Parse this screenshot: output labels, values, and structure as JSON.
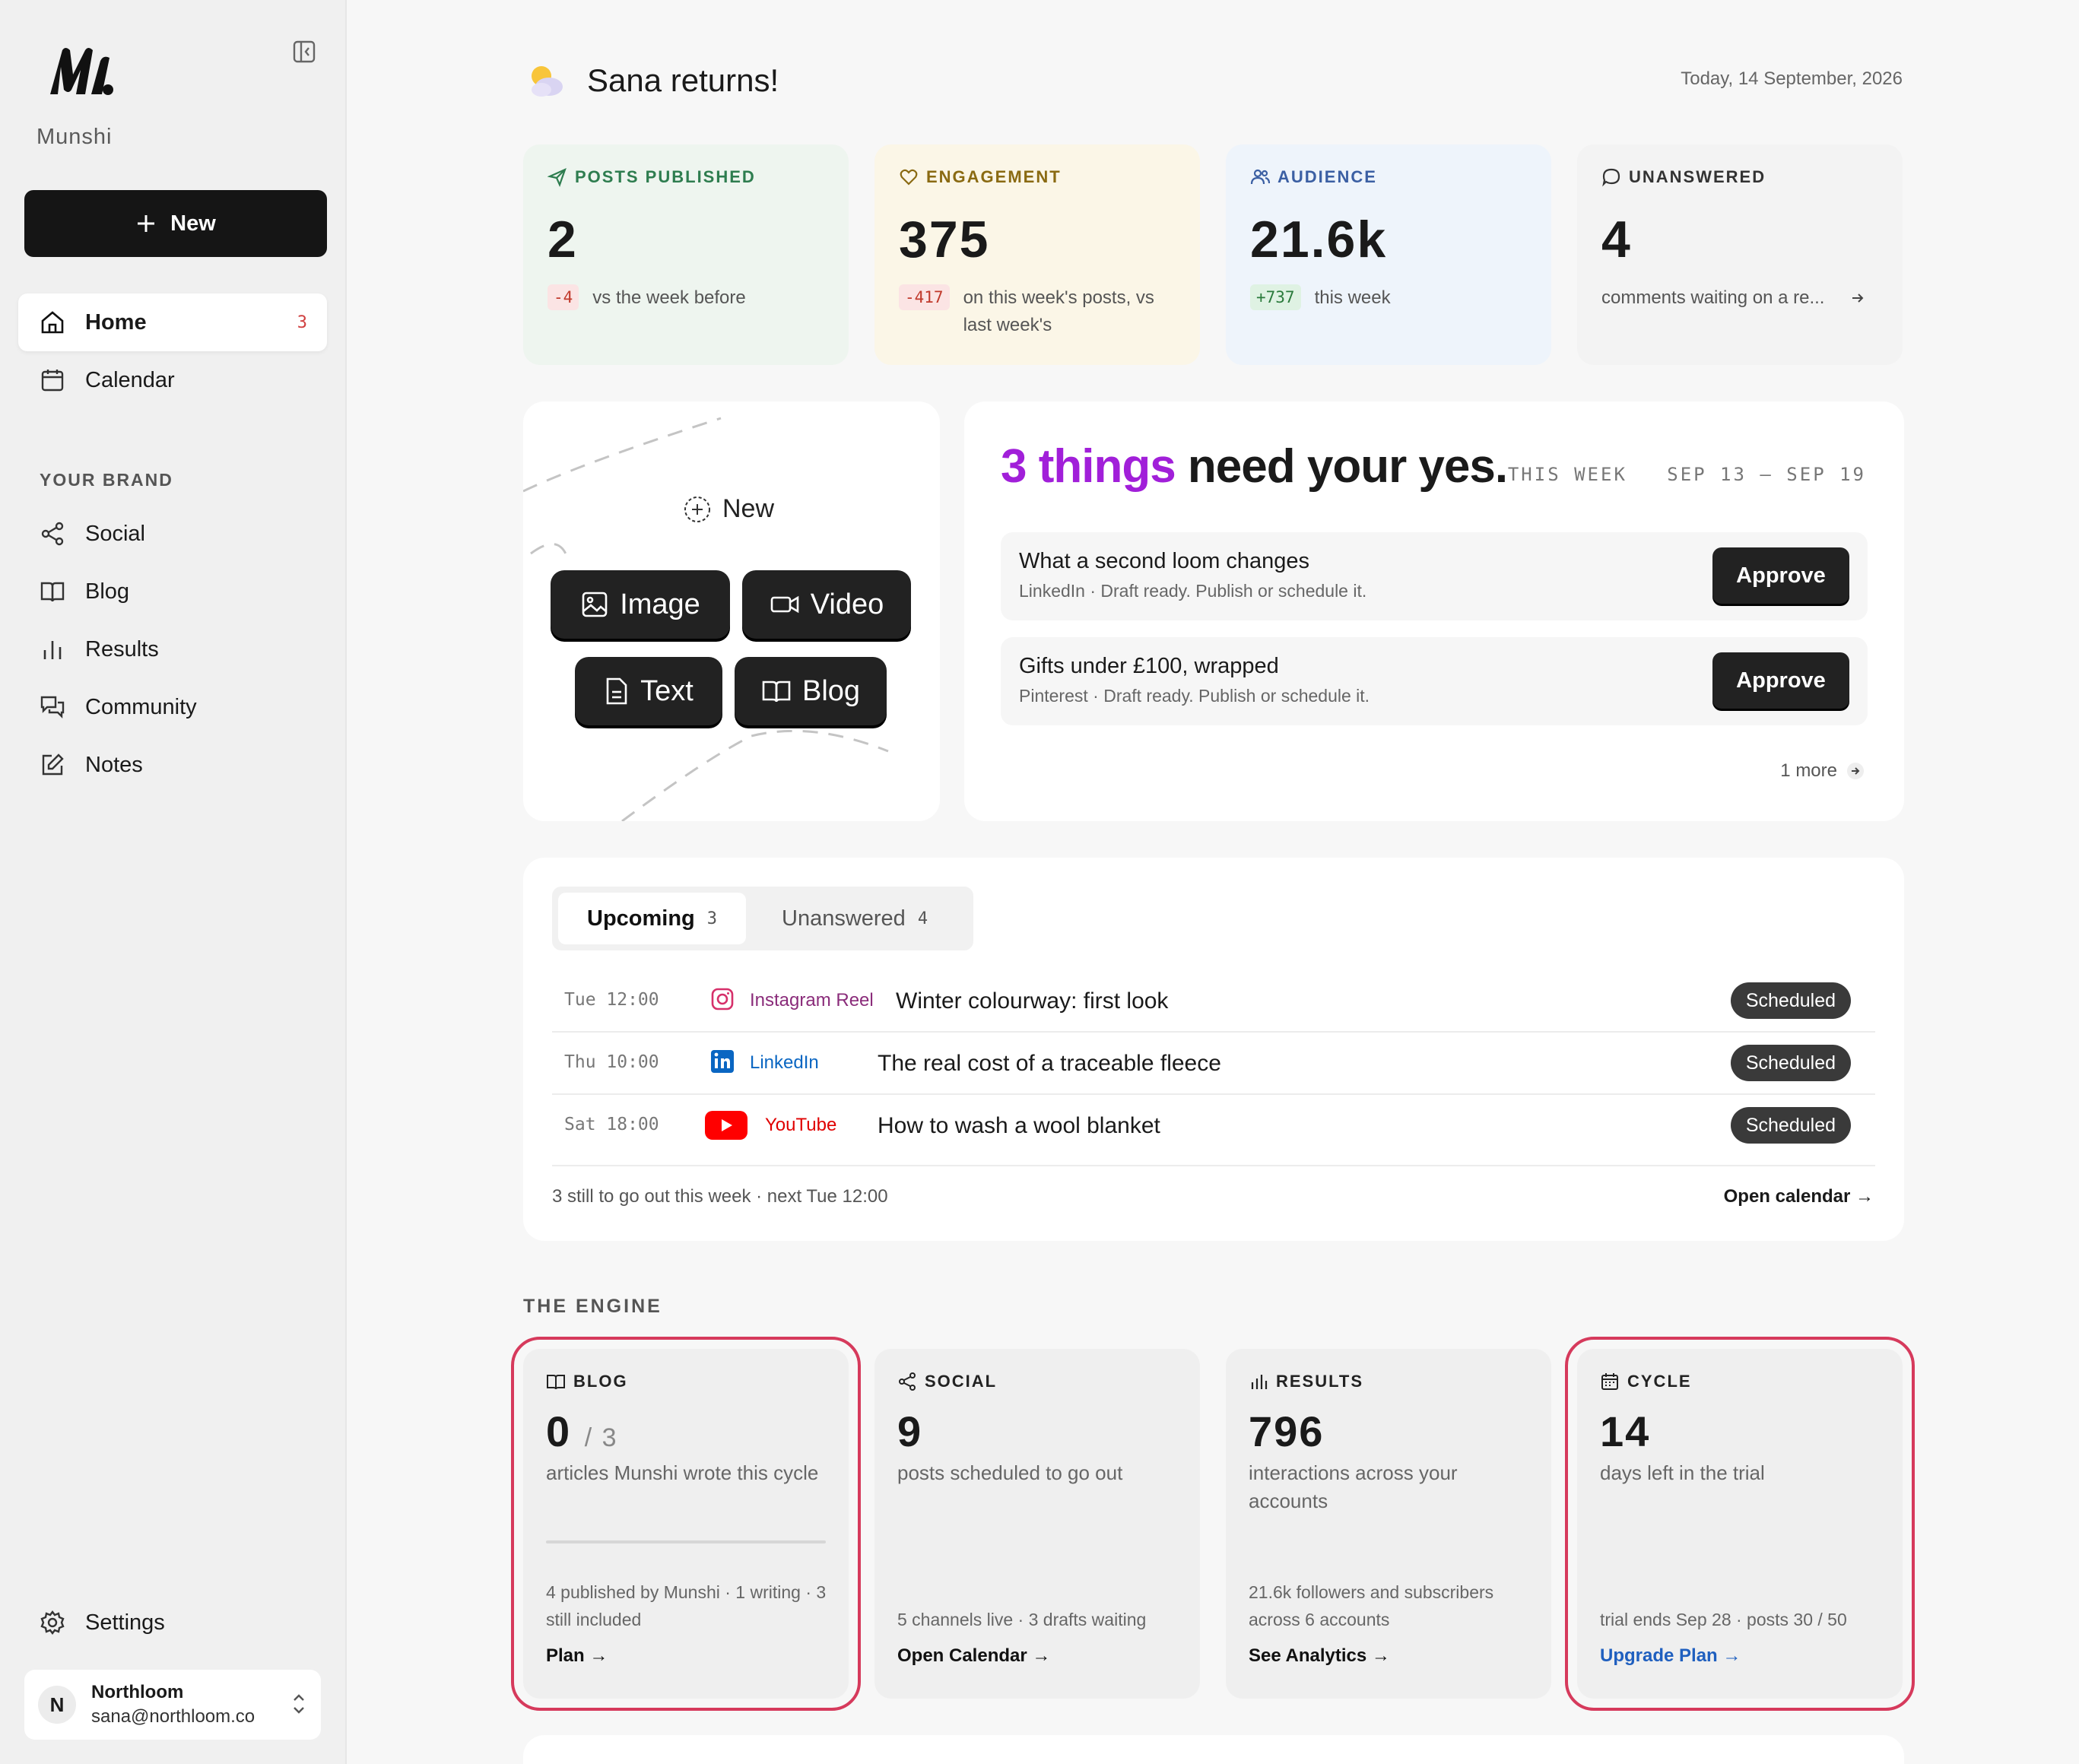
{
  "sidebar": {
    "brand": "Munshi",
    "new_label": "New",
    "nav": [
      {
        "label": "Home",
        "badge": "3"
      },
      {
        "label": "Calendar"
      }
    ],
    "section_label": "YOUR BRAND",
    "brand_nav": [
      {
        "label": "Social"
      },
      {
        "label": "Blog"
      },
      {
        "label": "Results"
      },
      {
        "label": "Community"
      },
      {
        "label": "Notes"
      }
    ],
    "settings_label": "Settings",
    "account": {
      "initial": "N",
      "name": "Northloom",
      "email": "sana@northloom.co"
    }
  },
  "header": {
    "greeting": "Sana returns!",
    "date": "Today, 14 September, 2026"
  },
  "stats": [
    {
      "label": "POSTS PUBLISHED",
      "value": "2",
      "delta": "-4",
      "sub": "vs the week before",
      "color": "#2e7d4f",
      "bg": "#eef5ef"
    },
    {
      "label": "ENGAGEMENT",
      "value": "375",
      "delta": "-417",
      "sub": "on this week's posts, vs last week's",
      "color": "#8a6a12",
      "bg": "#fbf6e7"
    },
    {
      "label": "AUDIENCE",
      "value": "21.6k",
      "delta": "+737",
      "sub": "this week",
      "color": "#3b5fa3",
      "bg": "#eef4fb"
    },
    {
      "label": "UNANSWERED",
      "value": "4",
      "sub": "comments waiting on a re...",
      "color": "#333333",
      "bg": "#f3f3f3"
    }
  ],
  "create": {
    "new_label": "New",
    "types": [
      "Image",
      "Video",
      "Text",
      "Blog"
    ]
  },
  "approvals": {
    "title_accent": "3 things",
    "title_rest": " need your yes.",
    "week_label": "THIS WEEK",
    "week_range": "SEP 13 – SEP 19",
    "items": [
      {
        "title": "What a second loom changes",
        "sub": "LinkedIn · Draft ready. Publish or schedule it.",
        "action": "Approve"
      },
      {
        "title": "Gifts under £100, wrapped",
        "sub": "Pinterest · Draft ready. Publish or schedule it.",
        "action": "Approve"
      }
    ],
    "more": "1 more"
  },
  "schedule": {
    "tabs": [
      {
        "label": "Upcoming",
        "count": "3"
      },
      {
        "label": "Unanswered",
        "count": "4"
      }
    ],
    "rows": [
      {
        "time": "Tue 12:00",
        "platform": "Instagram Reel",
        "title": "Winter colourway: first look",
        "status": "Scheduled"
      },
      {
        "time": "Thu 10:00",
        "platform": "LinkedIn",
        "title": "The real cost of a traceable fleece",
        "status": "Scheduled"
      },
      {
        "time": "Sat 18:00",
        "platform": "YouTube",
        "title": "How to wash a wool blanket",
        "status": "Scheduled"
      }
    ],
    "footer": "3 still to go out this week · next Tue 12:00",
    "link": "Open calendar →"
  },
  "engine": {
    "label": "THE ENGINE",
    "cards": [
      {
        "label": "BLOG",
        "value": "0",
        "value_sub": "/ 3",
        "desc": "articles Munshi wrote this cycle",
        "foot": "4 published by Munshi · 1 writing · 3 still included",
        "link": "Plan →",
        "progress": 0
      },
      {
        "label": "SOCIAL",
        "value": "9",
        "desc": "posts scheduled to go out",
        "foot": "5 channels live · 3 drafts waiting",
        "link": "Open Calendar →"
      },
      {
        "label": "RESULTS",
        "value": "796",
        "desc": "interactions across your accounts",
        "foot": "21.6k followers and subscribers across 6 accounts",
        "link": "See Analytics →"
      },
      {
        "label": "CYCLE",
        "value": "14",
        "desc": "days left in the trial",
        "foot": "trial ends Sep 28 · posts 30 / 50",
        "link": "Upgrade Plan →"
      }
    ]
  },
  "colors": {
    "accent": "#a11fd9",
    "highlight": "#d63a5c",
    "link_blue": "#1f5fbf",
    "instagram": "#d6306a",
    "linkedin": "#0a66c2",
    "youtube": "#ff0000"
  }
}
